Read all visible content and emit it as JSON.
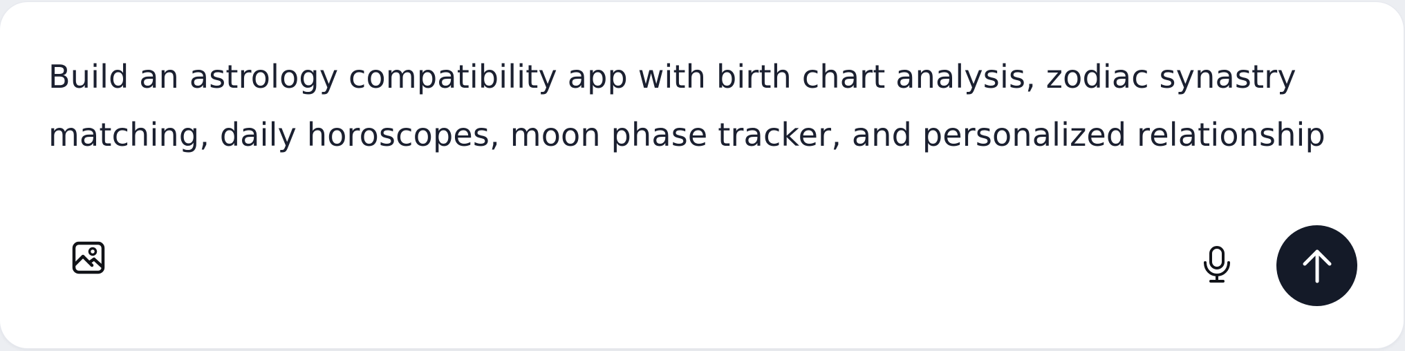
{
  "composer": {
    "prompt_text": "Build an astrology compatibility app with birth chart analysis, zodiac synastry matching, daily horoscopes, moon phase tracker, and personalized relationship",
    "attach_image_icon": "image-icon",
    "mic_icon": "microphone-icon",
    "send_icon": "arrow-up-icon"
  },
  "colors": {
    "background": "#eceef2",
    "card": "#ffffff",
    "text": "#1b2030",
    "send_button": "#141a28",
    "send_icon": "#ffffff"
  }
}
